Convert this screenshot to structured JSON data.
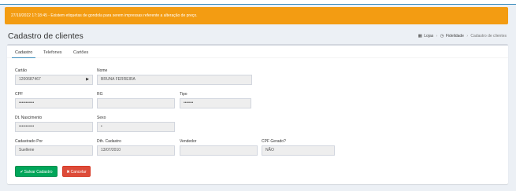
{
  "alert": {
    "text": "27/10/2022 17:18:45 - Existem etiquetas de gondola para serem impressas referente a alteração de preço."
  },
  "header": {
    "title": "Cadastro de clientes"
  },
  "breadcrumb": {
    "home": "Lojas",
    "mid": "Fidelidade",
    "current": "Cadastro de clientes"
  },
  "tabs": [
    "Cadastro",
    "Telefones",
    "Cartões"
  ],
  "form": {
    "cartao": {
      "label": "Cartão",
      "value": "1200687467"
    },
    "nome": {
      "label": "Nome",
      "value": "BRUNA FERREIRA"
    },
    "cpf": {
      "label": "CPF",
      "value": "•••••••••••"
    },
    "rg": {
      "label": "RG",
      "value": ""
    },
    "tipo": {
      "label": "Tipo",
      "value": "•••••••"
    },
    "dt_nascimento": {
      "label": "Dt. Nascimento",
      "value": "•••••••••••"
    },
    "sexo": {
      "label": "Sexo",
      "value": "•"
    },
    "cadastrado_por": {
      "label": "Cadastrado Por",
      "value": "Suellene"
    },
    "dt_cadastro": {
      "label": "Dth. Cadastro",
      "value": "13/07/2010"
    },
    "vendedor": {
      "label": "Vendedor",
      "value": ""
    },
    "cpf_gerado": {
      "label": "CPF Gerado?",
      "value": "NÃO"
    }
  },
  "buttons": {
    "save": "Salvar Cadastro",
    "cancel": "Cancelar"
  },
  "colors": {
    "alert": "#f39c12",
    "save": "#00a65a",
    "cancel": "#dd4b39",
    "accent": "#3c8dbc"
  }
}
